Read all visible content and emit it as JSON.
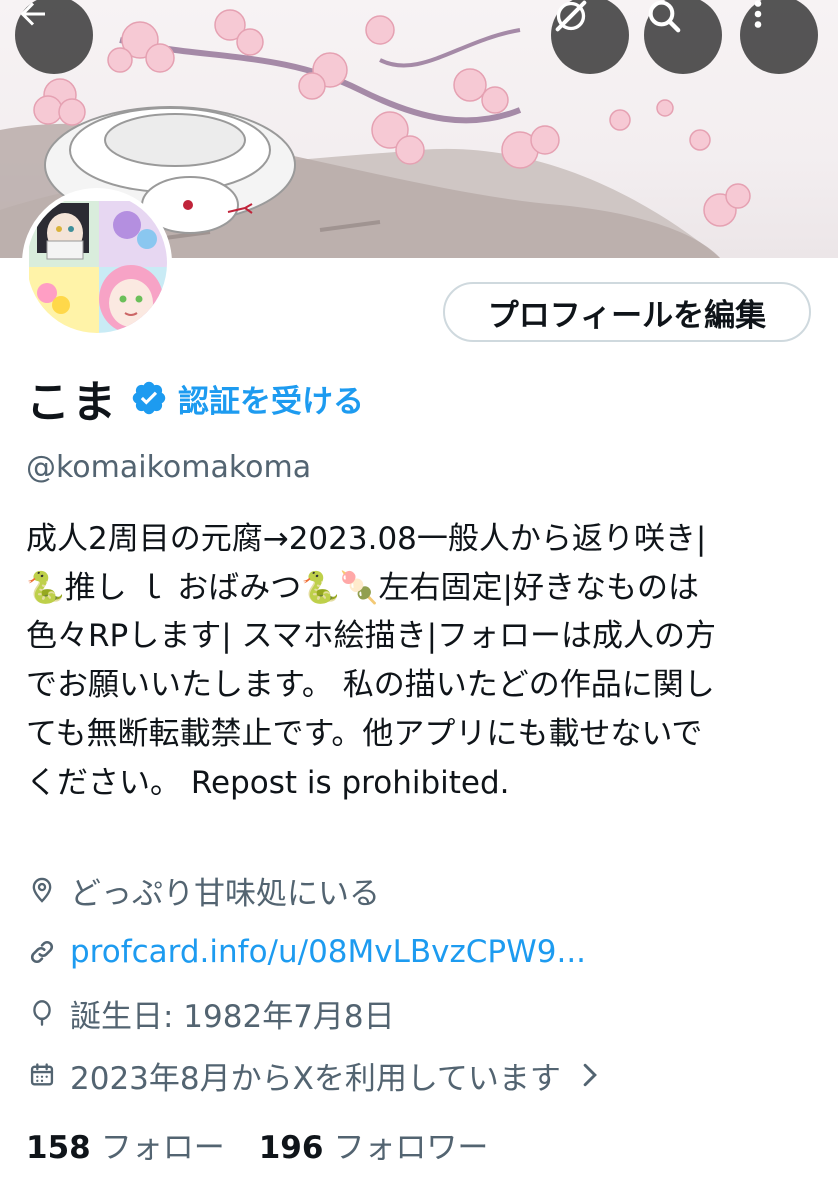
{
  "header": {
    "back_icon": "arrow-left-icon",
    "grok_icon": "grok-icon",
    "search_icon": "search-icon",
    "more_icon": "more-vertical-icon"
  },
  "profile": {
    "edit_button": "プロフィールを編集",
    "name": "こま",
    "verify_link": "認証を受ける",
    "handle": "@komaikomakoma",
    "bio": "成人2周目の元腐→2023.08一般人から返り咲き|\n🐍推し ｌ おばみつ🐍🍡左右固定|好きなものは\n色々RPします| スマホ絵描き|フォローは成人の方\nでお願いいたします。 私の描いたどの作品に関し\nても無断転載禁止です。他アプリにも載せないで\nください。 Repost is prohibited.",
    "location": "どっぷり甘味処にいる",
    "link": "profcard.info/u/08MvLBvzCPW9...",
    "birthday": "誕生日: 1982年7月8日",
    "joined": "2023年8月からXを利用しています",
    "following_count": "158",
    "following_label": "フォロー",
    "followers_count": "196",
    "followers_label": "フォロワー"
  },
  "colors": {
    "accent": "#1d9bf0",
    "secondary_text": "#536471",
    "primary_text": "#0f1419",
    "border": "#cfd9de"
  }
}
